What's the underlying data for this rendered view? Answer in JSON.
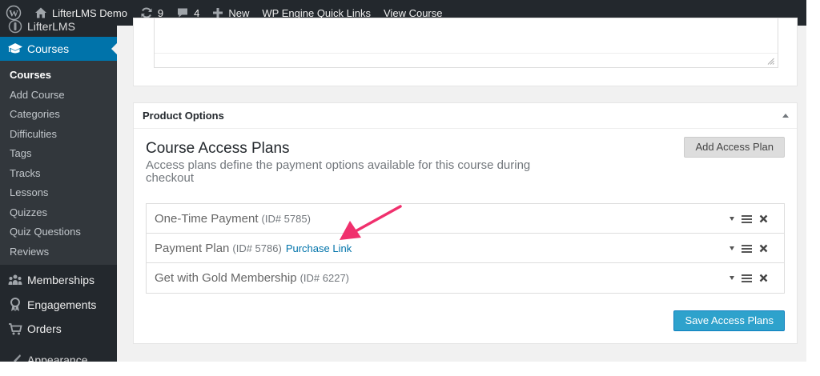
{
  "admin_bar": {
    "site_name": "LifterLMS Demo",
    "updates_count": "9",
    "comments_count": "4",
    "new_label": "New",
    "quick_links_label": "WP Engine Quick Links",
    "view_course_label": "View Course"
  },
  "sidebar": {
    "lifterlms_label": "LifterLMS",
    "courses_label": "Courses",
    "submenu": [
      "Courses",
      "Add Course",
      "Categories",
      "Difficulties",
      "Tags",
      "Tracks",
      "Lessons",
      "Quizzes",
      "Quiz Questions",
      "Reviews"
    ],
    "memberships_label": "Memberships",
    "engagements_label": "Engagements",
    "orders_label": "Orders",
    "appearance_label": "Appearance"
  },
  "product_options": {
    "title": "Product Options",
    "plans_title": "Course Access Plans",
    "plans_description": "Access plans define the payment options available for this course during checkout",
    "add_plan_label": "Add Access Plan",
    "save_plans_label": "Save Access Plans",
    "plans": [
      {
        "title": "One-Time Payment",
        "id": "(ID# 5785)",
        "link": ""
      },
      {
        "title": "Payment Plan",
        "id": "(ID# 5786)",
        "link": "Purchase Link"
      },
      {
        "title": "Get with Gold Membership",
        "id": "(ID# 6227)",
        "link": ""
      }
    ]
  },
  "colors": {
    "admin_bar_bg": "#23282d",
    "menu_active": "#0073aa",
    "primary_button": "#2ea2cc",
    "annotation_arrow": "#f0306d"
  }
}
